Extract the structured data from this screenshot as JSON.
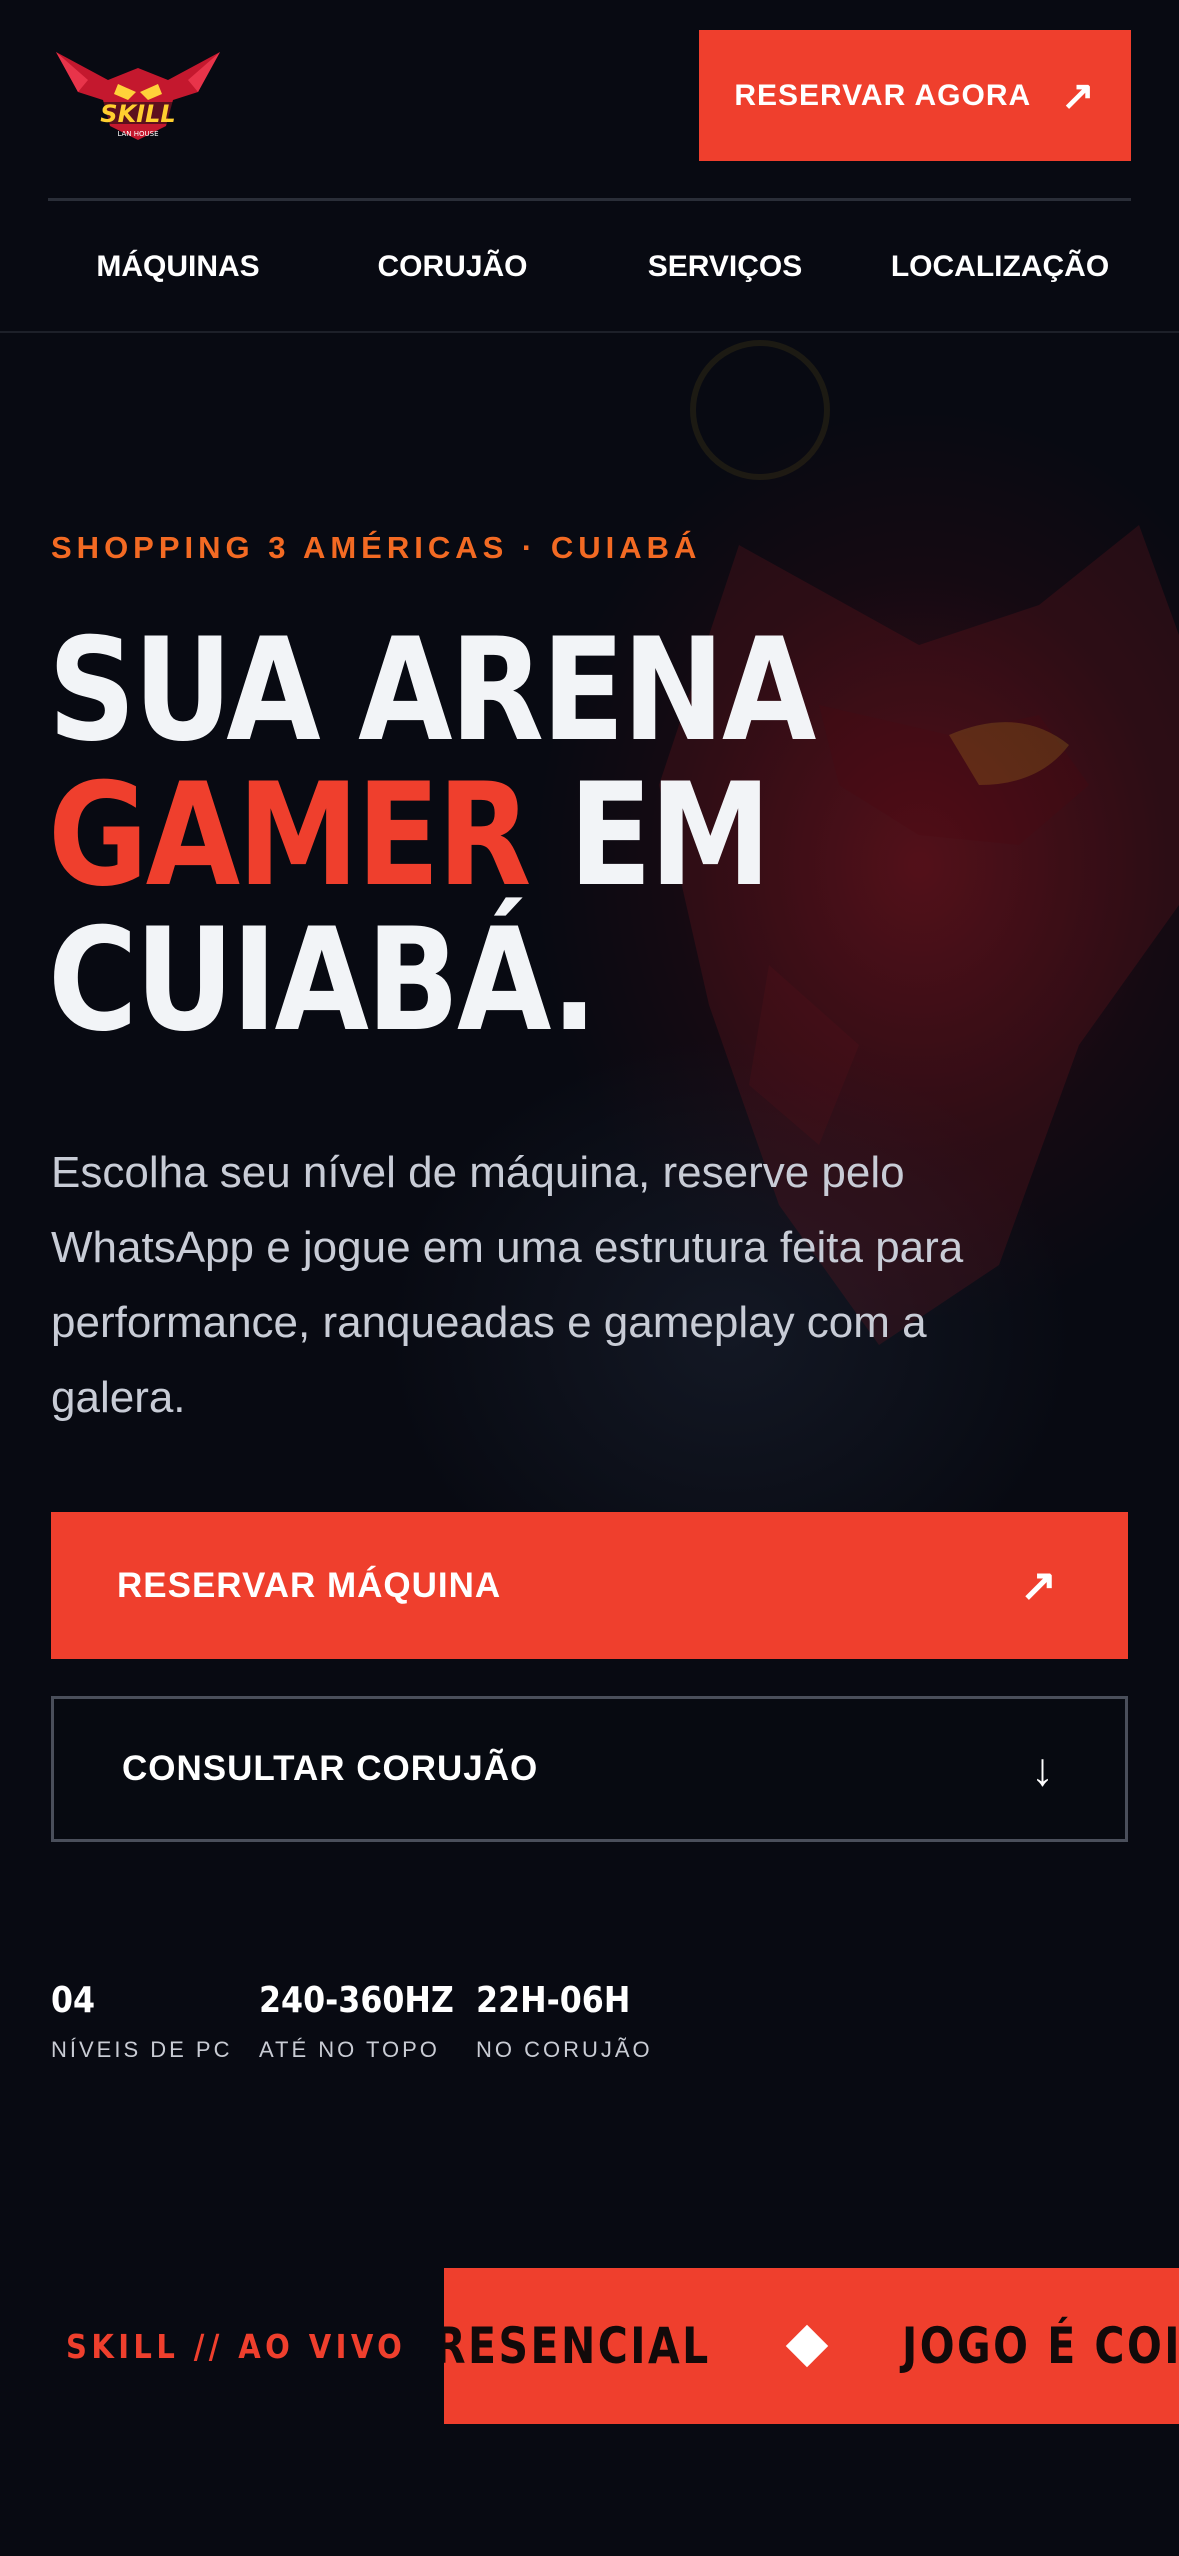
{
  "header": {
    "logo_text": "SKILL",
    "logo_subtext": "LAN HOUSE",
    "reserve_button": "RESERVAR AGORA",
    "reserve_icon": "arrow-up-right-icon"
  },
  "nav": {
    "items": [
      {
        "label": "MÁQUINAS"
      },
      {
        "label": "CORUJÃO"
      },
      {
        "label": "SERVIÇOS"
      },
      {
        "label": "LOCALIZAÇÃO"
      }
    ]
  },
  "hero": {
    "kicker": "SHOPPING 3 AMÉRICAS · CUIABÁ",
    "headline_line1": "SUA ARENA",
    "headline_accent": "GAMER",
    "headline_line2_rest": " EM",
    "headline_line3": "CUIABÁ.",
    "lede": "Escolha seu nível de máquina, reserve pelo WhatsApp e jogue em uma estrutura feita para performance, ranqueadas e gameplay com a galera.",
    "cta_primary": "RESERVAR MÁQUINA",
    "cta_primary_icon": "arrow-up-right-icon",
    "cta_secondary": "CONSULTAR CORUJÃO",
    "cta_secondary_icon": "arrow-down-icon"
  },
  "stats": [
    {
      "value": "04",
      "label": "NÍVEIS DE PC"
    },
    {
      "value": "240-360HZ",
      "label": "ATÉ NO TOPO"
    },
    {
      "value": "22H-06H",
      "label": "NO CORUJÃO"
    }
  ],
  "ticker": {
    "label": "SKILL // AO VIVO",
    "items": [
      "RESENCIAL",
      "JOGO É COISA"
    ]
  },
  "colors": {
    "background": "#080a12",
    "accent": "#ef3f2d",
    "kicker": "#f36a23",
    "text": "#f2f4f7",
    "muted": "#c8ccd6"
  }
}
